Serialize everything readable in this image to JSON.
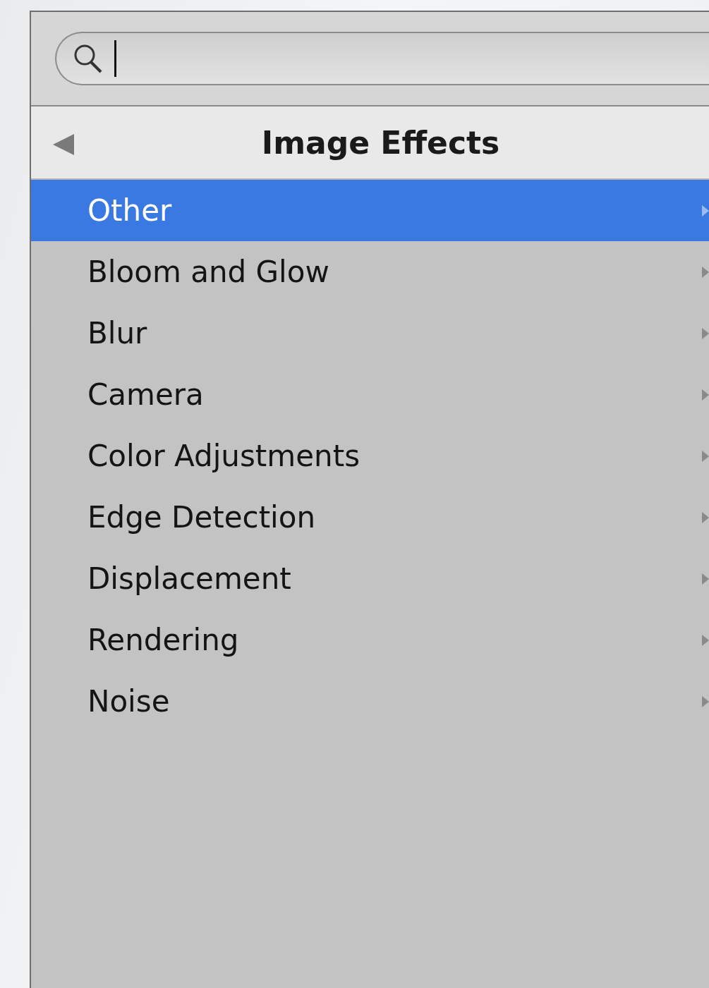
{
  "search": {
    "has_caret": true
  },
  "header": {
    "title": "Image Effects"
  },
  "items": [
    {
      "label": "Other",
      "selected": true
    },
    {
      "label": "Bloom and Glow",
      "selected": false
    },
    {
      "label": "Blur",
      "selected": false
    },
    {
      "label": "Camera",
      "selected": false
    },
    {
      "label": "Color Adjustments",
      "selected": false
    },
    {
      "label": "Edge Detection",
      "selected": false
    },
    {
      "label": "Displacement",
      "selected": false
    },
    {
      "label": "Rendering",
      "selected": false
    },
    {
      "label": "Noise",
      "selected": false
    }
  ]
}
